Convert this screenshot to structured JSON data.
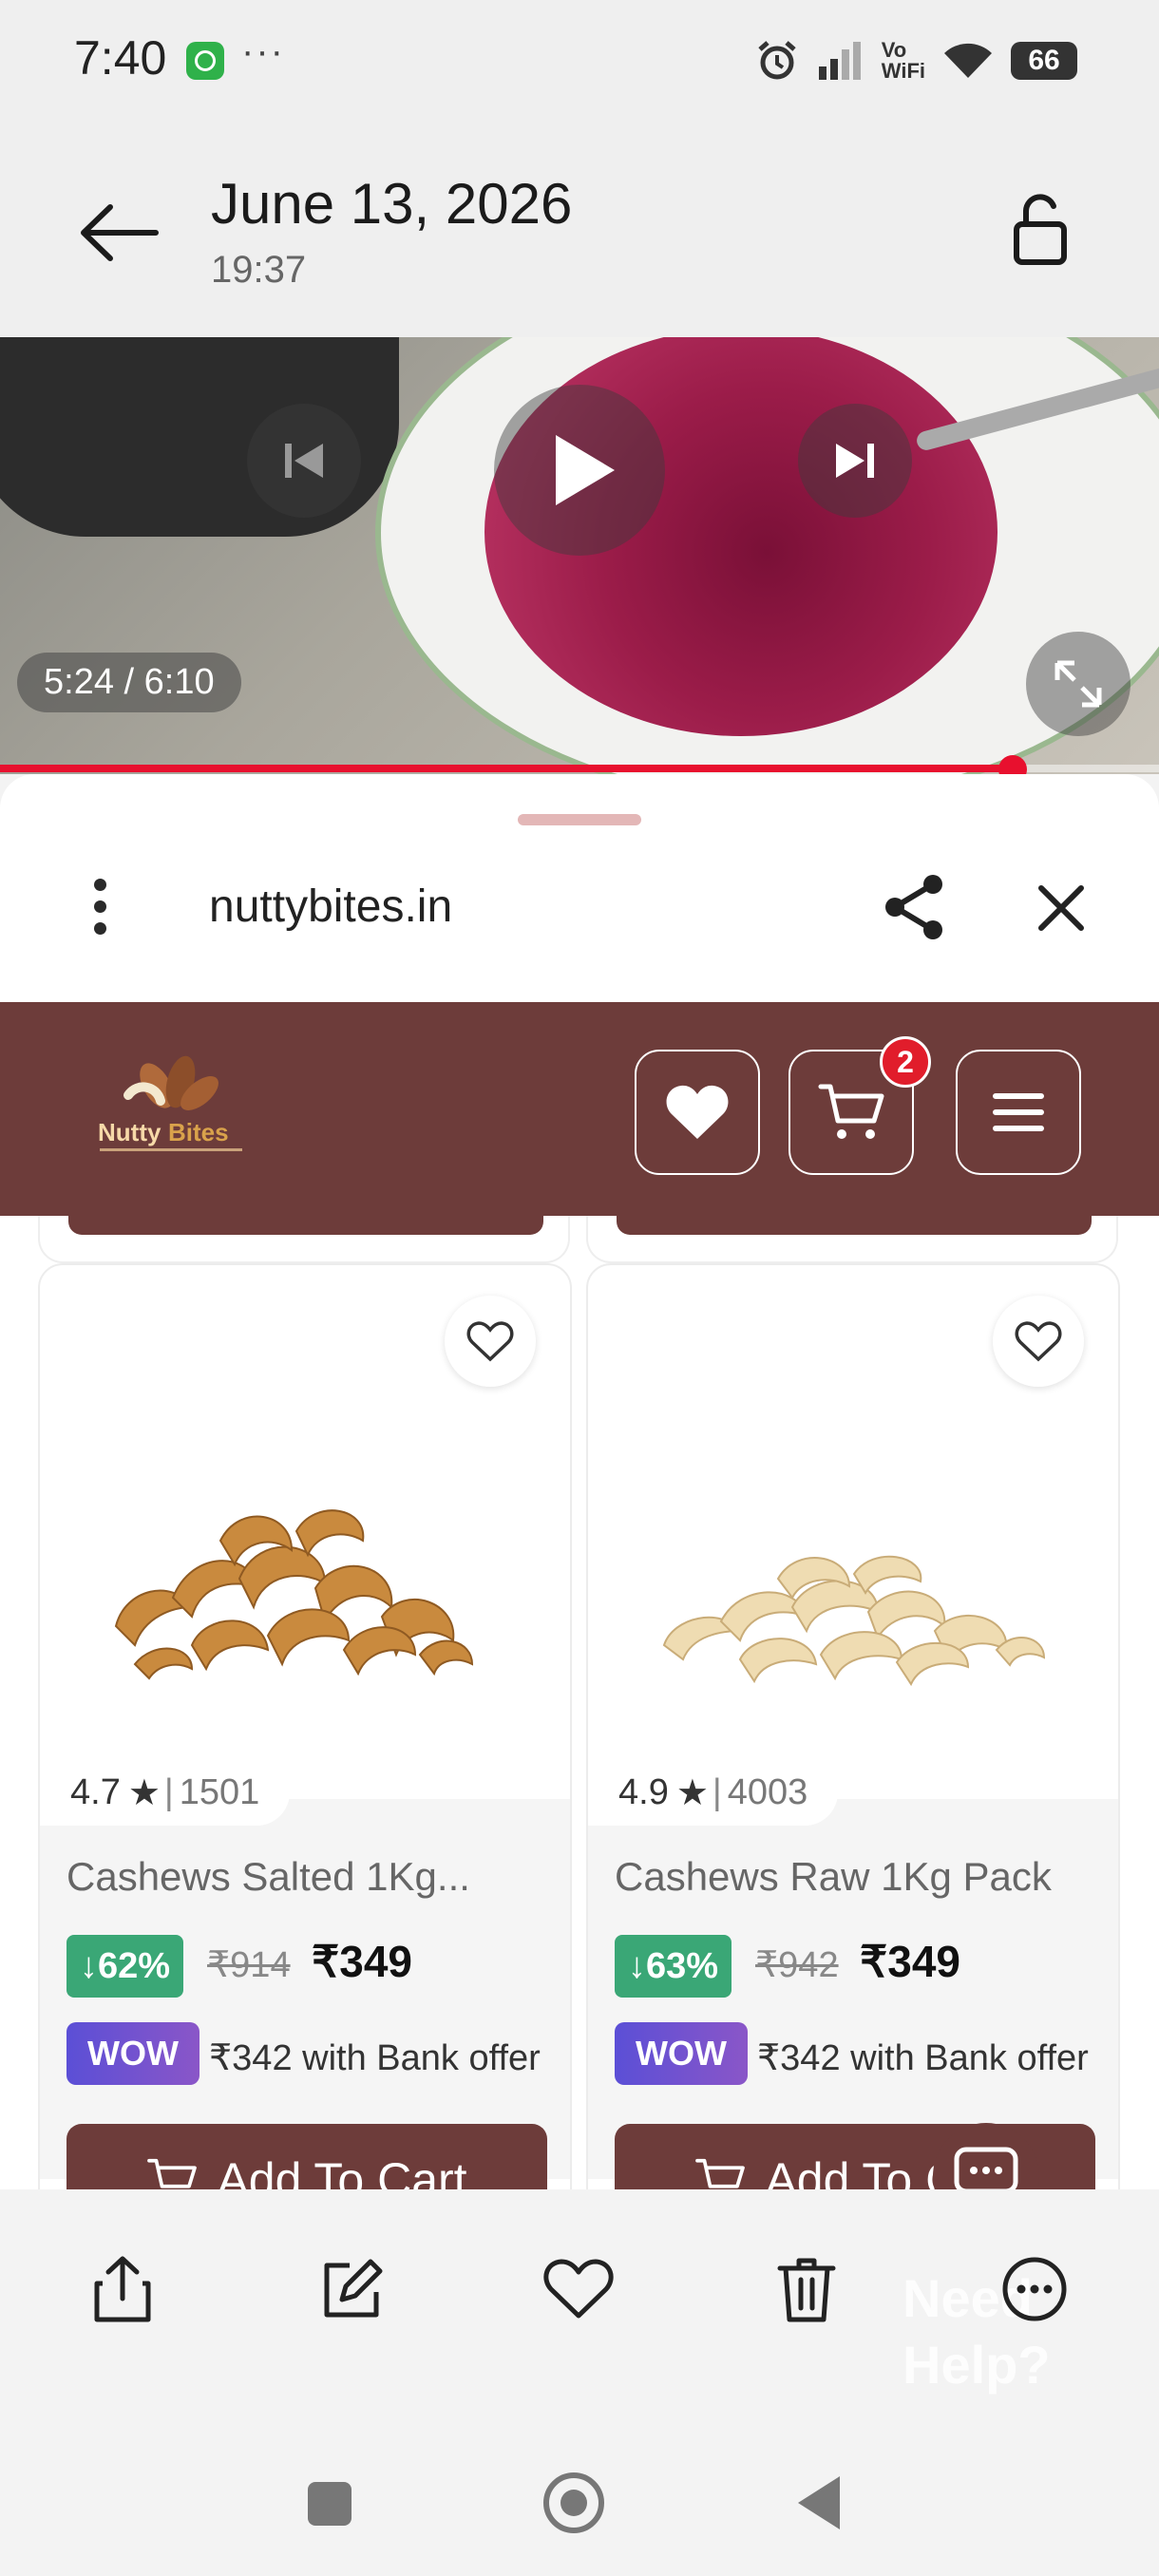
{
  "status_bar": {
    "time": "7:40",
    "dots": "···",
    "vowifi_line1": "Vo",
    "vowifi_line2": "WiFi",
    "battery": "66"
  },
  "header": {
    "date": "June 13, 2026",
    "time": "19:37"
  },
  "video": {
    "time_display": "5:24 / 6:10",
    "progress": 0.874
  },
  "browser": {
    "domain": "nuttybites.in"
  },
  "site_nav": {
    "logo_text_1": "Nutty",
    "logo_text_2": "Bites",
    "cart_count": "2"
  },
  "products": [
    {
      "rating": "4.7",
      "reviews": "1501",
      "name": "Cashews Salted 1Kg...",
      "discount": "↓62%",
      "mrp": "₹914",
      "price": "₹349",
      "wow": "WOW",
      "bank_offer": "₹342 with Bank offer",
      "cta": "Add To Cart"
    },
    {
      "rating": "4.9",
      "reviews": "4003",
      "name": "Cashews Raw 1Kg Pack",
      "discount": "↓63%",
      "mrp": "₹942",
      "price": "₹349",
      "wow": "WOW",
      "bank_offer": "₹342 with Bank offer",
      "cta": "Add To Cart"
    }
  ],
  "toolbar": {
    "ghost_text": "Need Help?"
  },
  "colors": {
    "brand": "#6d3c3a",
    "discount": "#3aa776",
    "badge": "#e11d2b",
    "video_progress": "#e8102e"
  }
}
